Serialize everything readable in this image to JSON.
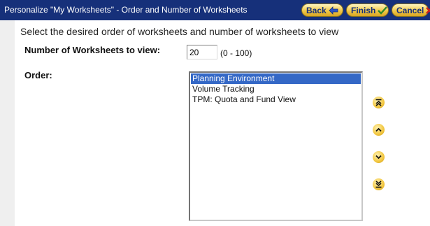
{
  "header": {
    "title": "Personalize \"My Worksheets\" - Order and Number of Worksheets",
    "back_label": "Back",
    "finish_label": "Finish",
    "cancel_label": "Cancel"
  },
  "main": {
    "instructions": "Select the desired order of worksheets and number of worksheets to view",
    "count_label": "Number of Worksheets to view:",
    "count_value": "20",
    "count_range": "(0 - 100)",
    "order_label": "Order:",
    "worksheets": [
      {
        "label": "Planning Environment",
        "selected": true
      },
      {
        "label": "Volume Tracking",
        "selected": false
      },
      {
        "label": "TPM: Quota and Fund View",
        "selected": false
      }
    ]
  },
  "icons": {
    "back": "back-arrow-icon",
    "finish": "checkmark-icon",
    "cancel": "close-icon",
    "move_top": "double-chevron-up-icon",
    "move_up": "chevron-up-icon",
    "move_down": "chevron-down-icon",
    "move_bottom": "double-chevron-down-icon"
  },
  "colors": {
    "header_bg": "#16307a",
    "button_gold": "#f0c84a",
    "selection": "#3468c6",
    "page_bg": "#efefef"
  }
}
